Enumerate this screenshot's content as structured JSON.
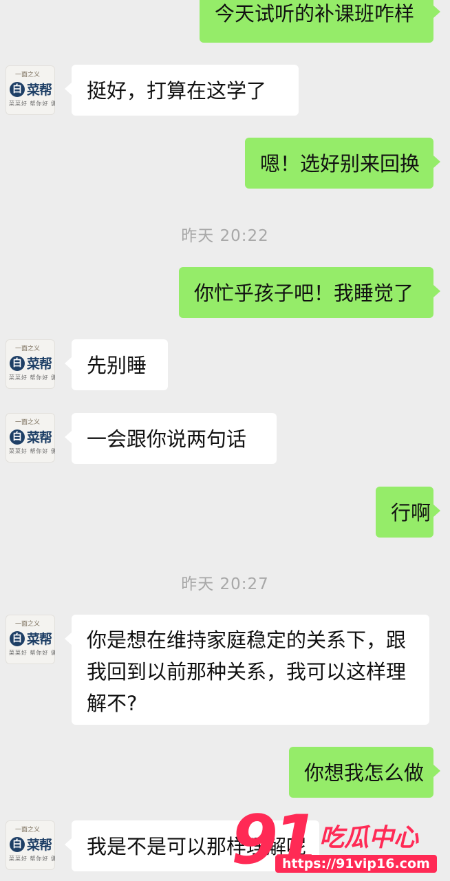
{
  "contact": {
    "avatar": {
      "top_text": "一面之义",
      "logo_letter": "白",
      "logo_text": "菜帮",
      "sub_text": "菜菜好 帮你好 健康好"
    }
  },
  "messages": [
    {
      "side": "out",
      "text": "今天试听的补课班咋样"
    },
    {
      "side": "in",
      "text": "挺好，打算在这学了"
    },
    {
      "side": "out",
      "text": "嗯！选好别来回换"
    },
    {
      "side": "time",
      "text": "昨天 20:22"
    },
    {
      "side": "out",
      "text": "你忙乎孩子吧！我睡觉了"
    },
    {
      "side": "in",
      "text": "先别睡"
    },
    {
      "side": "in",
      "text": "一会跟你说两句话"
    },
    {
      "side": "out",
      "text": "行啊"
    },
    {
      "side": "time",
      "text": "昨天 20:27"
    },
    {
      "side": "in",
      "text": "你是想在维持家庭稳定的关系下，跟我回到以前那种关系，我可以这样理解不?"
    },
    {
      "side": "out",
      "text": "你想我怎么做"
    },
    {
      "side": "in",
      "text": "我是不是可以那样理解呢"
    }
  ],
  "watermark": {
    "number": "91",
    "brand": "吃瓜中心",
    "url": "https://91vip16.com"
  },
  "colors": {
    "background": "#ededed",
    "outgoing_bubble": "#95ec69",
    "incoming_bubble": "#ffffff",
    "timestamp": "#a8a8a8",
    "watermark": "#ff2a55"
  }
}
